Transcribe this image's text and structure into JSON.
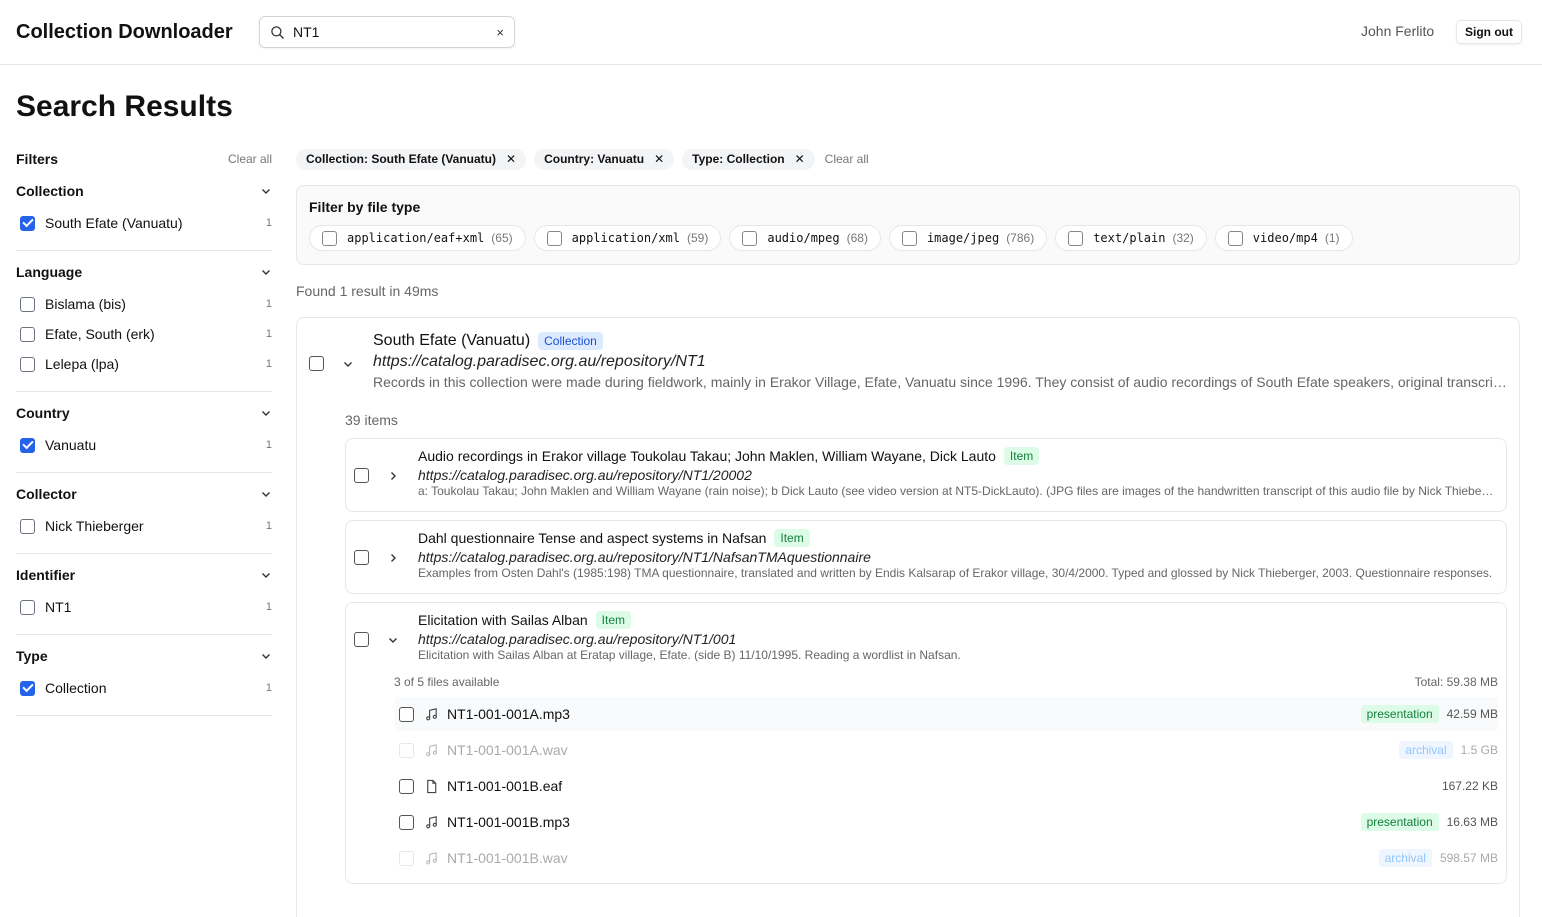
{
  "app": {
    "title": "Collection Downloader",
    "user": "John Ferlito",
    "signout": "Sign out"
  },
  "search": {
    "value": "NT1",
    "clear": "×"
  },
  "page": {
    "title": "Search Results"
  },
  "filters": {
    "title": "Filters",
    "clear_all": "Clear all",
    "groups": [
      {
        "name": "Collection",
        "options": [
          {
            "label": "South Efate (Vanuatu)",
            "count": "1",
            "checked": true
          }
        ]
      },
      {
        "name": "Language",
        "options": [
          {
            "label": "Bislama (bis)",
            "count": "1",
            "checked": false
          },
          {
            "label": "Efate, South (erk)",
            "count": "1",
            "checked": false
          },
          {
            "label": "Lelepa (lpa)",
            "count": "1",
            "checked": false
          }
        ]
      },
      {
        "name": "Country",
        "options": [
          {
            "label": "Vanuatu",
            "count": "1",
            "checked": true
          }
        ]
      },
      {
        "name": "Collector",
        "options": [
          {
            "label": "Nick Thieberger",
            "count": "1",
            "checked": false
          }
        ]
      },
      {
        "name": "Identifier",
        "options": [
          {
            "label": "NT1",
            "count": "1",
            "checked": false
          }
        ]
      },
      {
        "name": "Type",
        "options": [
          {
            "label": "Collection",
            "count": "1",
            "checked": true
          }
        ]
      }
    ]
  },
  "active_filters": {
    "chips": [
      "Collection: South Efate (Vanuatu)",
      "Country: Vanuatu",
      "Type: Collection"
    ],
    "clear_all": "Clear all"
  },
  "file_type": {
    "title": "Filter by file type",
    "types": [
      {
        "name": "application/eaf+xml",
        "count": "(65)"
      },
      {
        "name": "application/xml",
        "count": "(59)"
      },
      {
        "name": "audio/mpeg",
        "count": "(68)"
      },
      {
        "name": "image/jpeg",
        "count": "(786)"
      },
      {
        "name": "text/plain",
        "count": "(32)"
      },
      {
        "name": "video/mp4",
        "count": "(1)"
      }
    ]
  },
  "found": "Found 1 result in 49ms",
  "result": {
    "title": "South Efate (Vanuatu)",
    "badge": "Collection",
    "url": "https://catalog.paradisec.org.au/repository/NT1",
    "description": "Records in this collection were made during fieldwork, mainly in Erakor Village, Efate, Vanuatu since 1996. They consist of audio recordings of South Efate speakers, original transcripts and notes.",
    "items_count": "39 items",
    "items": [
      {
        "title": "Audio recordings in Erakor village Toukolau Takau; John Maklen, William Wayane, Dick Lauto",
        "badge": "Item",
        "url": "https://catalog.paradisec.org.au/repository/NT1/20002",
        "description": "a: Toukolau Takau; John Maklen and William Wayane (rain noise); b Dick Lauto (see video version at NT5-DickLauto). (JPG files are images of the handwritten transcript of this audio file by Nick Thieberger)"
      },
      {
        "title": "Dahl questionnaire Tense and aspect systems in Nafsan",
        "badge": "Item",
        "url": "https://catalog.paradisec.org.au/repository/NT1/NafsanTMAquestionnaire",
        "description": "Examples from Osten Dahl's (1985:198) TMA questionnaire, translated and written by Endis Kalsarap of Erakor village, 30/4/2000. Typed and glossed by Nick Thieberger, 2003. Questionnaire responses."
      },
      {
        "title": "Elicitation with Sailas Alban",
        "badge": "Item",
        "url": "https://catalog.paradisec.org.au/repository/NT1/001",
        "description": "Elicitation with Sailas Alban at Eratap village, Efate. (side B) 11/10/1995. Reading a wordlist in Nafsan.",
        "files_available": "3 of 5 files available",
        "total": "Total: 59.38 MB",
        "files": [
          {
            "name": "NT1-001-001A.mp3",
            "icon": "music-note-icon",
            "tag": "presentation",
            "size": "42.59 MB"
          },
          {
            "name": "NT1-001-001A.wav",
            "icon": "music-note-icon",
            "tag": "archival",
            "size": "1.5 GB"
          },
          {
            "name": "NT1-001-001B.eaf",
            "icon": "file-icon",
            "tag": "",
            "size": "167.22 KB"
          },
          {
            "name": "NT1-001-001B.mp3",
            "icon": "music-note-icon",
            "tag": "presentation",
            "size": "16.63 MB"
          },
          {
            "name": "NT1-001-001B.wav",
            "icon": "music-note-icon",
            "tag": "archival",
            "size": "598.57 MB"
          }
        ]
      }
    ]
  },
  "colors": {
    "accent": "#2563eb",
    "collection_badge_bg": "#dbeafe",
    "item_badge_bg": "#dcfce7"
  }
}
